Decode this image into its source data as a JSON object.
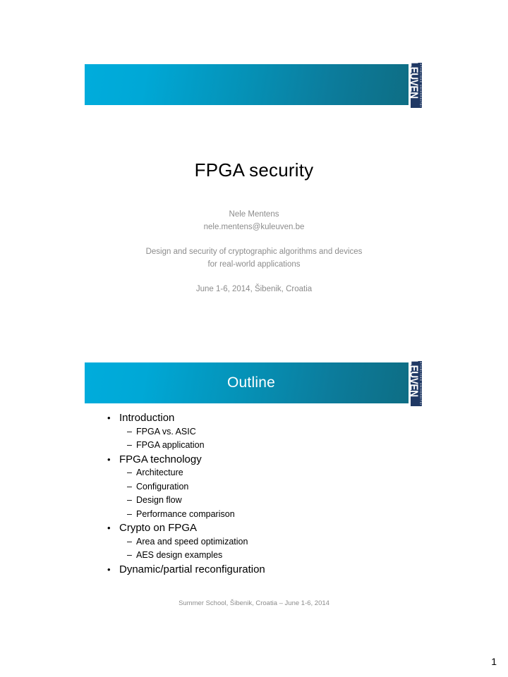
{
  "brand": {
    "logo_word": "LEUVEN",
    "logo_subtitle": "KATHOLIEKE UNIVERSITEIT",
    "gradient_start": "#00ACDC",
    "gradient_end": "#0E6B80",
    "logo_background": "#1F3864"
  },
  "slide1": {
    "title": "FPGA security",
    "author": "Nele Mentens",
    "email": "nele.mentens@kuleuven.be",
    "course_line1": "Design and security of cryptographic algorithms and devices",
    "course_line2": "for real-world applications",
    "event_date": "June 1-6, 2014, Šibenik, Croatia"
  },
  "slide2": {
    "banner_title": "Outline",
    "footer": "Summer School, Šibenik, Croatia – June 1-6, 2014",
    "page_number": "1",
    "bullet_marker": "•",
    "dash_marker": "–",
    "items": [
      {
        "label": "Introduction",
        "sub": [
          "FPGA vs. ASIC",
          "FPGA application"
        ]
      },
      {
        "label": "FPGA technology",
        "sub": [
          "Architecture",
          "Configuration",
          "Design flow",
          "Performance comparison"
        ]
      },
      {
        "label": "Crypto on FPGA",
        "sub": [
          "Area and speed optimization",
          "AES design examples"
        ]
      },
      {
        "label": "Dynamic/partial reconfiguration",
        "sub": []
      }
    ]
  }
}
